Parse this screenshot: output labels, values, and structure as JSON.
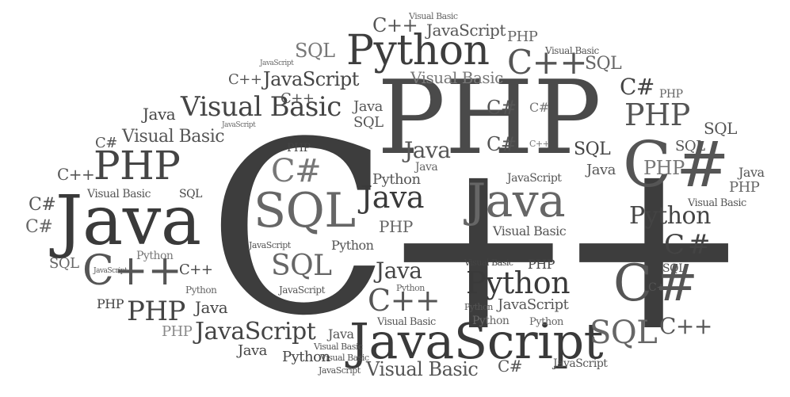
{
  "cloud": {
    "colors": {
      "dark": "#3a3a3a",
      "mid": "#555555",
      "light": "#707070",
      "pale": "#8a8a8a"
    },
    "words": [
      "C",
      "++",
      "PHP",
      "Java",
      "JavaScript",
      "Python",
      "C++",
      "C#",
      "SQL",
      "Visual Basic"
    ]
  }
}
